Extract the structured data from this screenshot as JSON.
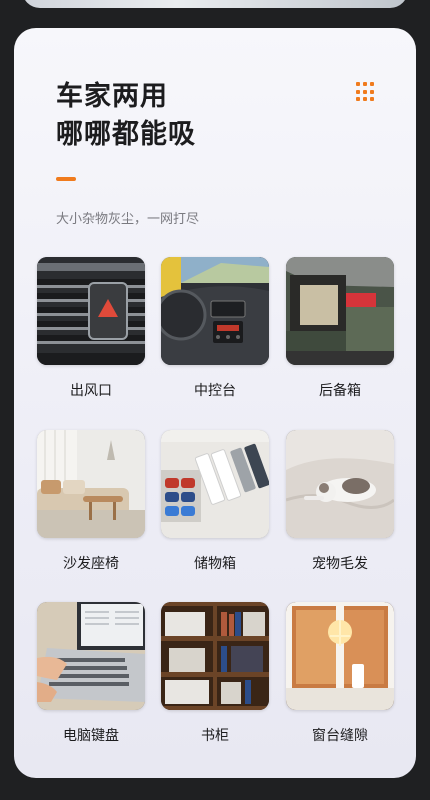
{
  "heading": {
    "line1": "车家两用",
    "line2": "哪哪都能吸"
  },
  "subtitle": "大小杂物灰尘，一网打尽",
  "accent_color": "#f07b1d",
  "menu_icon": "grid-dots-icon",
  "items": [
    {
      "label": "出风口"
    },
    {
      "label": "中控台"
    },
    {
      "label": "后备箱"
    },
    {
      "label": "沙发座椅"
    },
    {
      "label": "储物箱"
    },
    {
      "label": "宠物毛发"
    },
    {
      "label": "电脑键盘"
    },
    {
      "label": "书柜"
    },
    {
      "label": "窗台缝隙"
    }
  ]
}
